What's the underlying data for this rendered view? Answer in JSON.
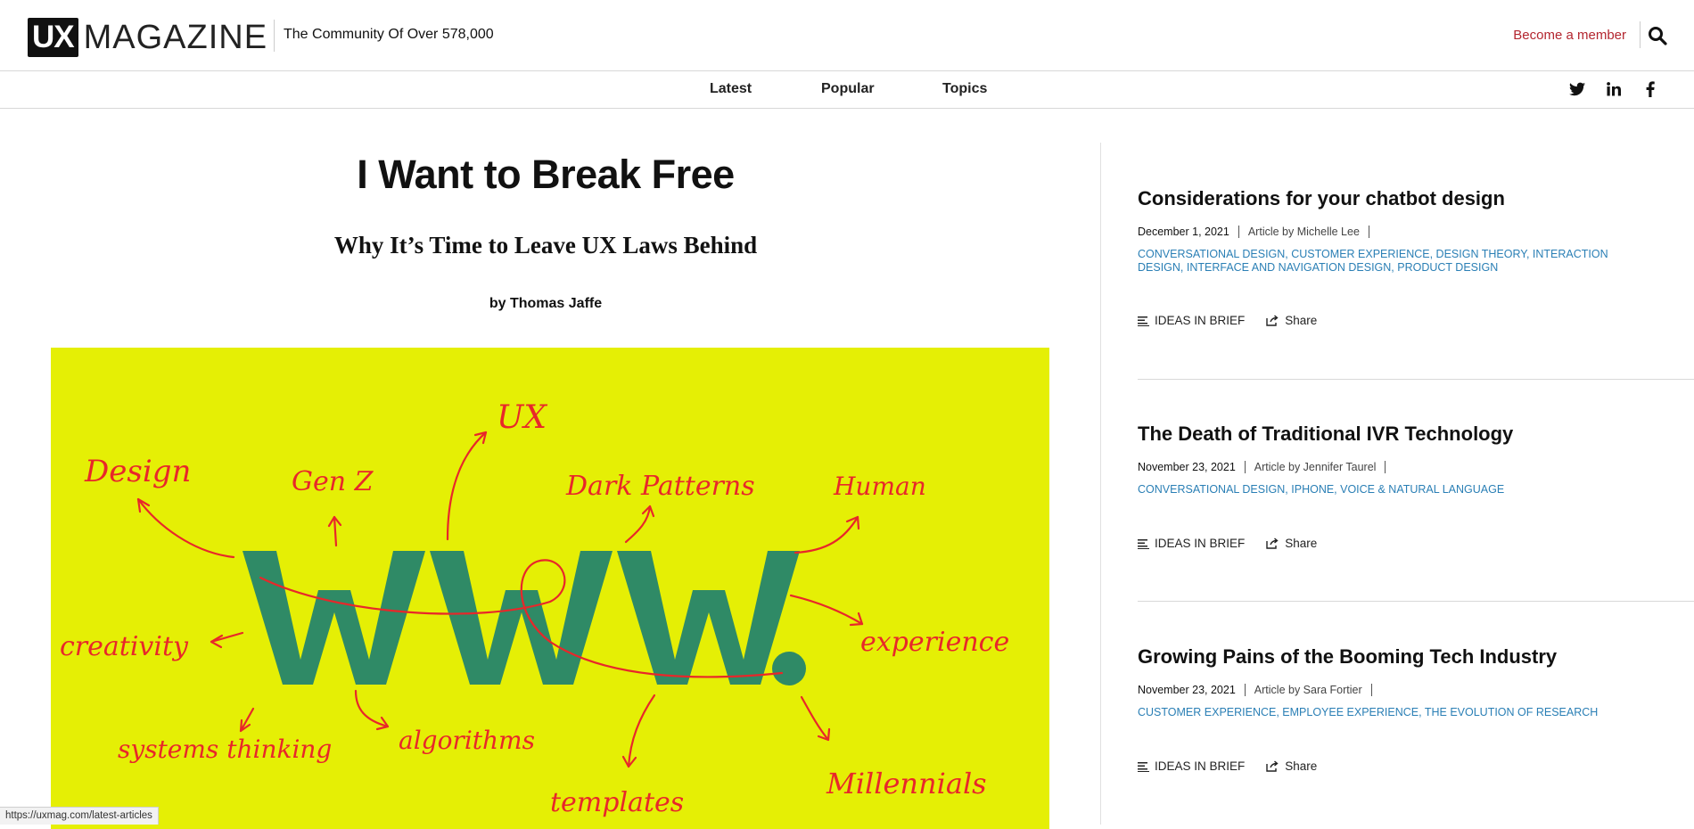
{
  "header": {
    "logo_ux": "UX",
    "logo_magazine": "MAGAZINE",
    "tagline": "The Community Of Over 578,000",
    "member_link": "Become a member",
    "search_icon": "search-icon",
    "brand_red": "#b3262f"
  },
  "nav": {
    "items": [
      {
        "label": "Latest"
      },
      {
        "label": "Popular"
      },
      {
        "label": "Topics"
      }
    ],
    "social": [
      "twitter-icon",
      "linkedin-icon",
      "facebook-icon"
    ]
  },
  "article": {
    "title": "I Want to Break Free",
    "subtitle": "Why It’s Time to Leave UX Laws Behind",
    "byline": "by Thomas Jaffe",
    "hero": {
      "background": "#e5ef05",
      "www_color": "#2f8a66",
      "ink_color": "#e8272a",
      "center_text": "WWW",
      "words": [
        "UX",
        "Design",
        "Gen Z",
        "Dark Patterns",
        "Human",
        "creativity",
        "experience",
        "algorithms",
        "systems thinking",
        "templates",
        "Millennials"
      ]
    }
  },
  "sidebar": {
    "cards": [
      {
        "title": "Considerations for your chatbot design",
        "date": "December 1, 2021",
        "author": "Article by Michelle Lee",
        "tags": "CONVERSATIONAL DESIGN, CUSTOMER EXPERIENCE, DESIGN THEORY, INTERACTION DESIGN, INTERFACE AND NAVIGATION DESIGN, PRODUCT DESIGN",
        "brief": "IDEAS IN BRIEF",
        "share": "Share"
      },
      {
        "title": "The Death of Traditional IVR Technology",
        "date": "November 23, 2021",
        "author": "Article by Jennifer Taurel",
        "tags": "CONVERSATIONAL DESIGN, IPHONE, VOICE & NATURAL LANGUAGE",
        "brief": "IDEAS IN BRIEF",
        "share": "Share"
      },
      {
        "title": "Growing Pains of the Booming Tech Industry",
        "date": "November 23, 2021",
        "author": "Article by Sara Fortier",
        "tags": "CUSTOMER EXPERIENCE, EMPLOYEE EXPERIENCE, THE EVOLUTION OF RESEARCH",
        "brief": "IDEAS IN BRIEF",
        "share": "Share"
      }
    ],
    "tag_color": "#2a7fb5"
  },
  "status_bar": {
    "url": "https://uxmag.com/latest-articles"
  }
}
